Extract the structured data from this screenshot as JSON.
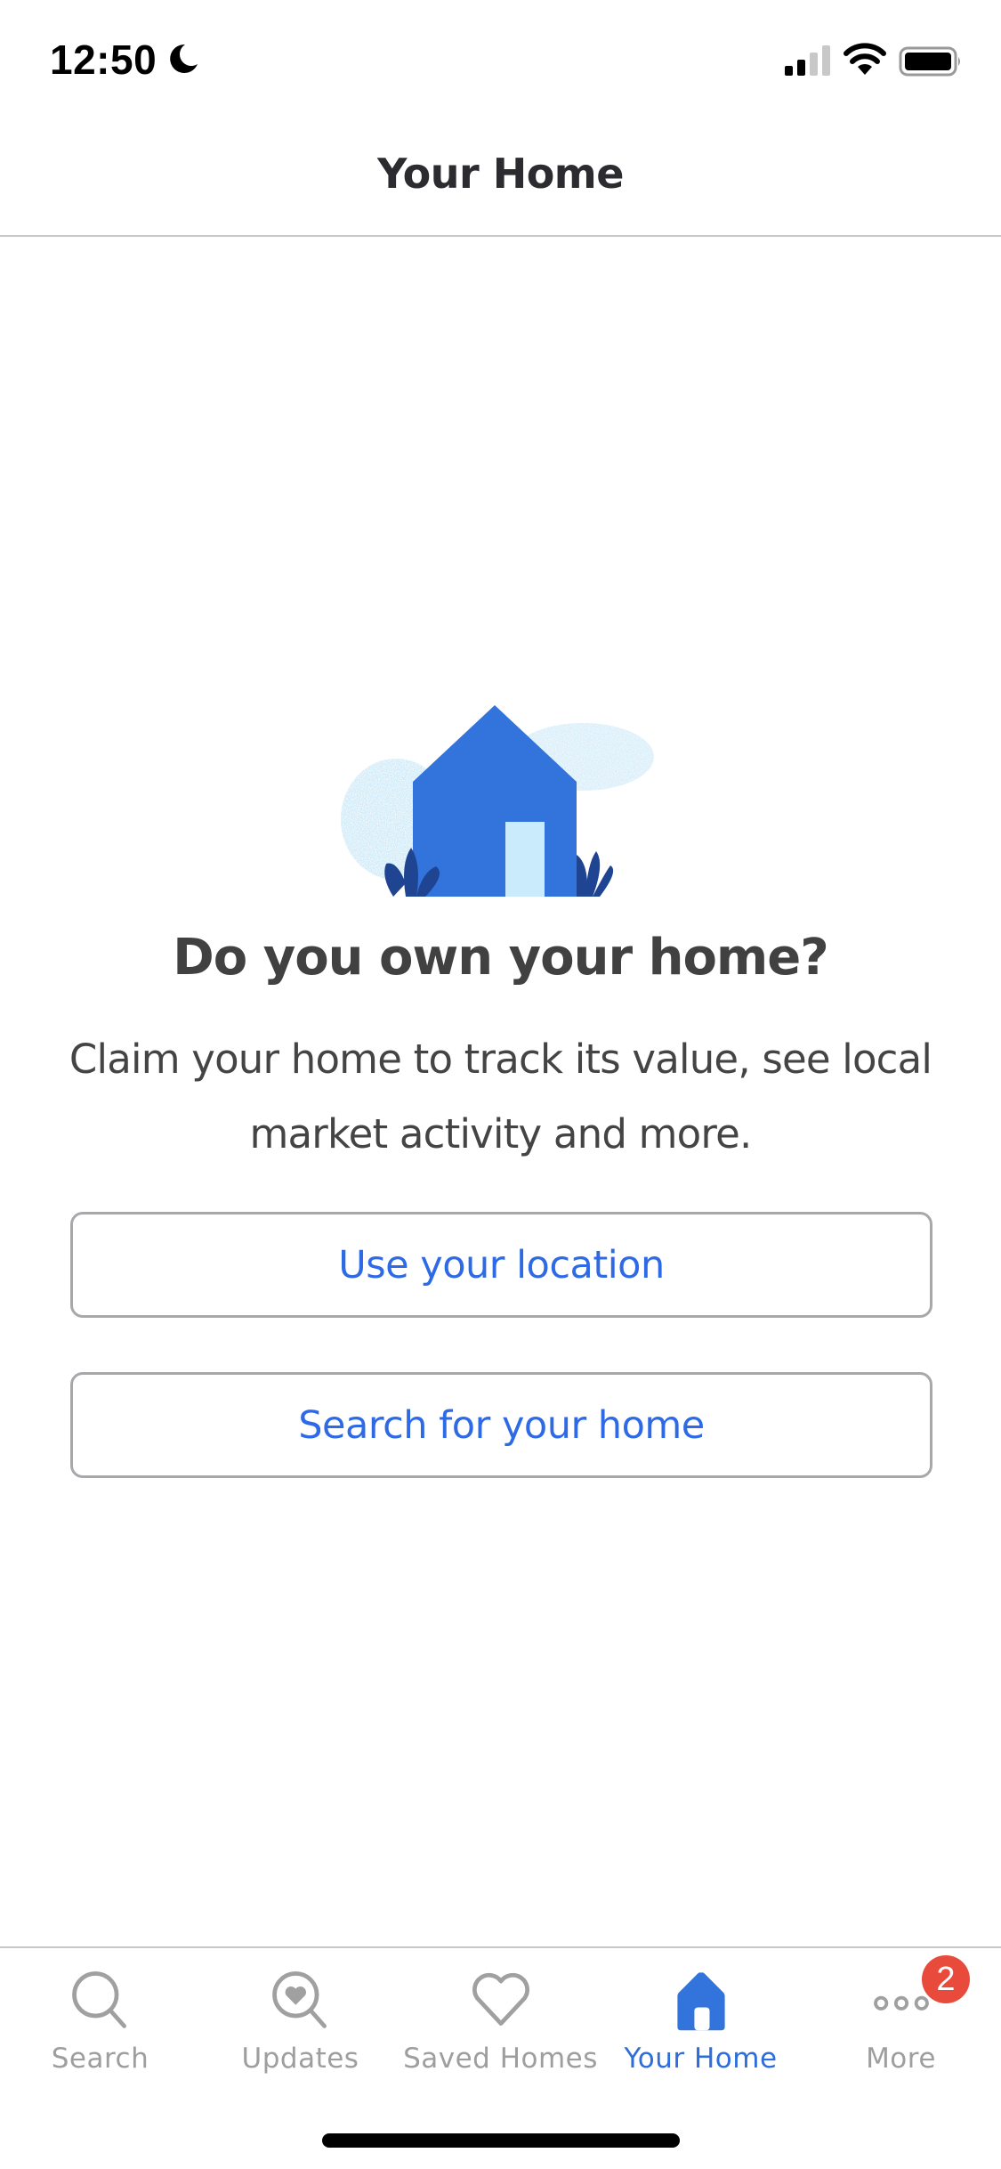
{
  "status_bar": {
    "time": "12:50",
    "focus_icon": "moon-icon",
    "signal_bars_active": 2,
    "signal_bars_total": 4,
    "wifi_icon": "wifi-icon",
    "battery_level": 1.0
  },
  "nav": {
    "title": "Your Home"
  },
  "main": {
    "heading": "Do you own your home?",
    "subtext": "Claim your home to track its value, see local market activity and more.",
    "buttons": {
      "use_location": "Use your location",
      "search_home": "Search for your home"
    }
  },
  "tab_bar": {
    "tabs": [
      {
        "label": "Search",
        "icon": "search-icon",
        "active": false
      },
      {
        "label": "Updates",
        "icon": "updates-heart-search-icon",
        "active": false
      },
      {
        "label": "Saved Homes",
        "icon": "heart-icon",
        "active": false
      },
      {
        "label": "Your Home",
        "icon": "house-icon",
        "active": true
      },
      {
        "label": "More",
        "icon": "more-dots-icon",
        "active": false,
        "badge": "2"
      }
    ]
  },
  "colors": {
    "accent": "#2f6ae6",
    "house_blue": "#3273dc",
    "plant_dark": "#1f4592",
    "door_light": "#c9ebfb",
    "cloud": "#cdeaf8",
    "badge_red": "#e84b3c",
    "inactive_gray": "#9e9e9e"
  }
}
